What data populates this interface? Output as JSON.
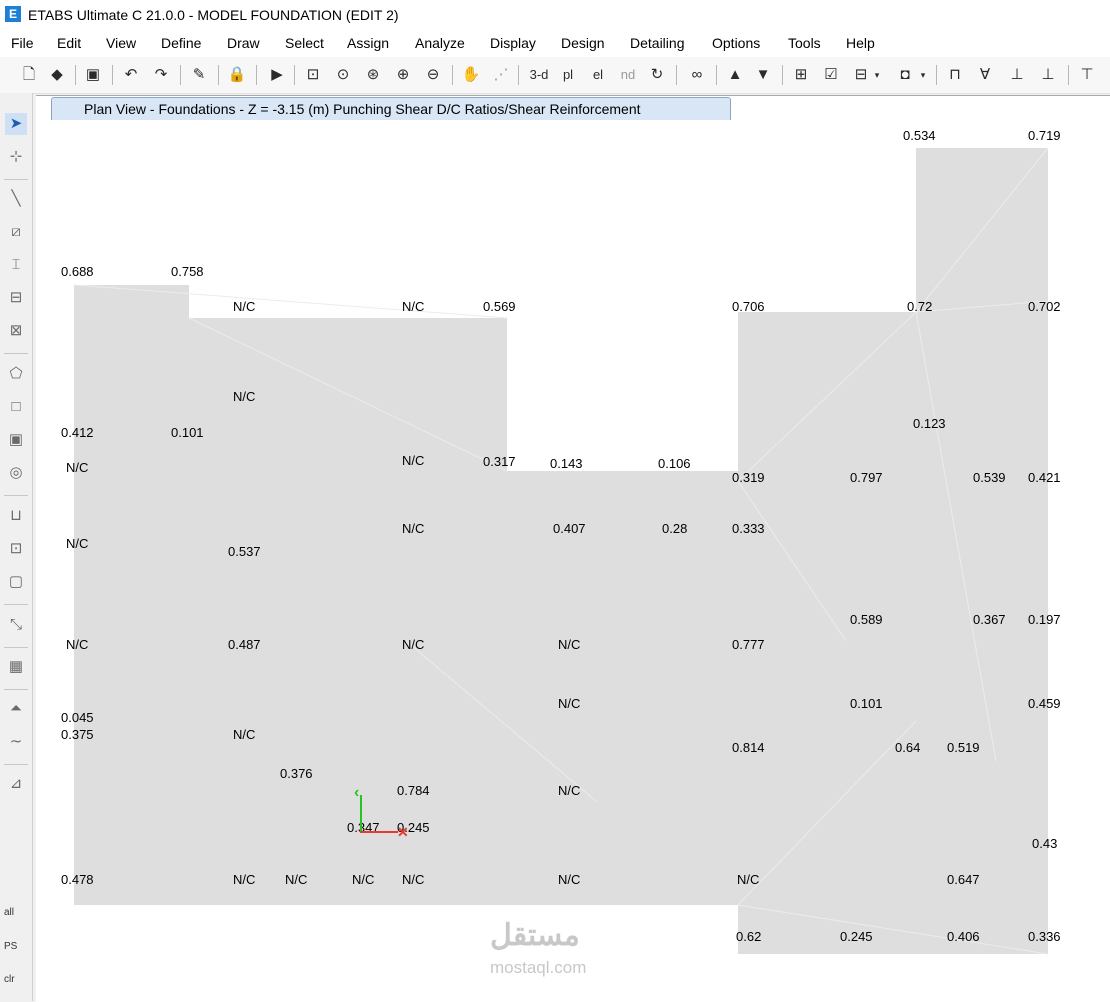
{
  "window": {
    "title": "ETABS Ultimate C 21.0.0 - MODEL FOUNDATION (EDIT 2)",
    "app_icon": "E"
  },
  "menu": [
    "File",
    "Edit",
    "View",
    "Define",
    "Draw",
    "Select",
    "Assign",
    "Analyze",
    "Display",
    "Design",
    "Detailing",
    "Options",
    "Tools",
    "Help"
  ],
  "toolbar": {
    "three_d": "3-d",
    "plan": "pl",
    "elev": "el",
    "nd": "nd"
  },
  "sidetool": {
    "all": "all",
    "ps": "PS",
    "clr": "clr"
  },
  "view": {
    "tab_title": "Plan View - Foundations - Z = -3.15 (m)  Punching Shear D/C Ratios/Shear Reinforcement"
  },
  "labels": [
    "0.534",
    "0.719",
    "0.688",
    "0.758",
    "N/C",
    "N/C",
    "0.569",
    "0.706",
    "0.72",
    "0.702",
    "N/C",
    "0.123",
    "0.412",
    "0.101",
    "N/C",
    "N/C",
    "0.317",
    "0.143",
    "0.106",
    "0.319",
    "0.797",
    "0.539",
    "0.421",
    "N/C",
    "0.407",
    "0.28",
    "0.333",
    "N/C",
    "0.537",
    "0.589",
    "0.367",
    "0.197",
    "N/C",
    "0.487",
    "N/C",
    "N/C",
    "0.777",
    "N/C",
    "0.101",
    "0.459",
    "0.045",
    "0.375",
    "N/C",
    "0.814",
    "0.64",
    "0.519",
    "0.376",
    "0.784",
    "N/C",
    "0.347",
    "0.245",
    "0.43",
    "0.478",
    "N/C",
    "N/C",
    "N/C",
    "N/C",
    "N/C",
    "N/C",
    "0.647",
    "0.62",
    "0.245",
    "0.406",
    "0.336"
  ],
  "colors": {
    "slab": "#dedede",
    "x_axis": "#e83b2c",
    "y_axis": "#25c425",
    "tab": "#d9e6f6"
  },
  "watermark": {
    "arabic": "مستقل",
    "latin": "mostaql.com"
  }
}
